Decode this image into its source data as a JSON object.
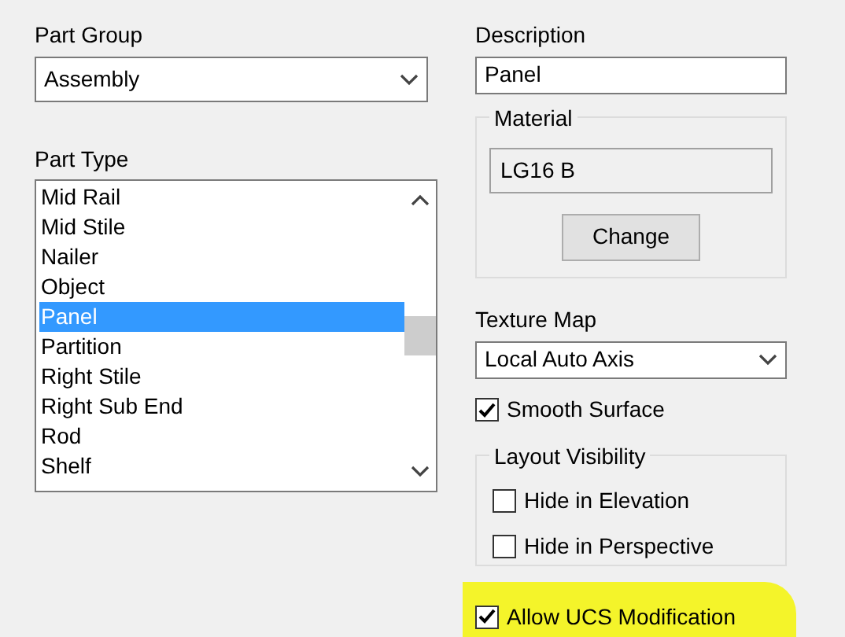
{
  "part_group": {
    "label": "Part Group",
    "value": "Assembly"
  },
  "part_type": {
    "label": "Part Type",
    "items": [
      {
        "label": "Mid Rail",
        "selected": false
      },
      {
        "label": "Mid Stile",
        "selected": false
      },
      {
        "label": "Nailer",
        "selected": false
      },
      {
        "label": "Object",
        "selected": false
      },
      {
        "label": "Panel",
        "selected": true
      },
      {
        "label": "Partition",
        "selected": false
      },
      {
        "label": "Right Stile",
        "selected": false
      },
      {
        "label": "Right Sub End",
        "selected": false
      },
      {
        "label": "Rod",
        "selected": false
      },
      {
        "label": "Shelf",
        "selected": false
      }
    ]
  },
  "description": {
    "label": "Description",
    "value": "Panel"
  },
  "material": {
    "title": "Material",
    "value": "LG16 B",
    "button": "Change"
  },
  "texture_map": {
    "label": "Texture Map",
    "value": "Local Auto Axis"
  },
  "smooth_surface": {
    "label": "Smooth Surface",
    "checked": true
  },
  "layout_visibility": {
    "title": "Layout Visibility",
    "options": [
      {
        "label": "Hide in Elevation",
        "checked": false
      },
      {
        "label": "Hide in Perspective",
        "checked": false
      }
    ]
  },
  "allow_ucs": {
    "label": "Allow UCS Modification",
    "checked": true
  }
}
